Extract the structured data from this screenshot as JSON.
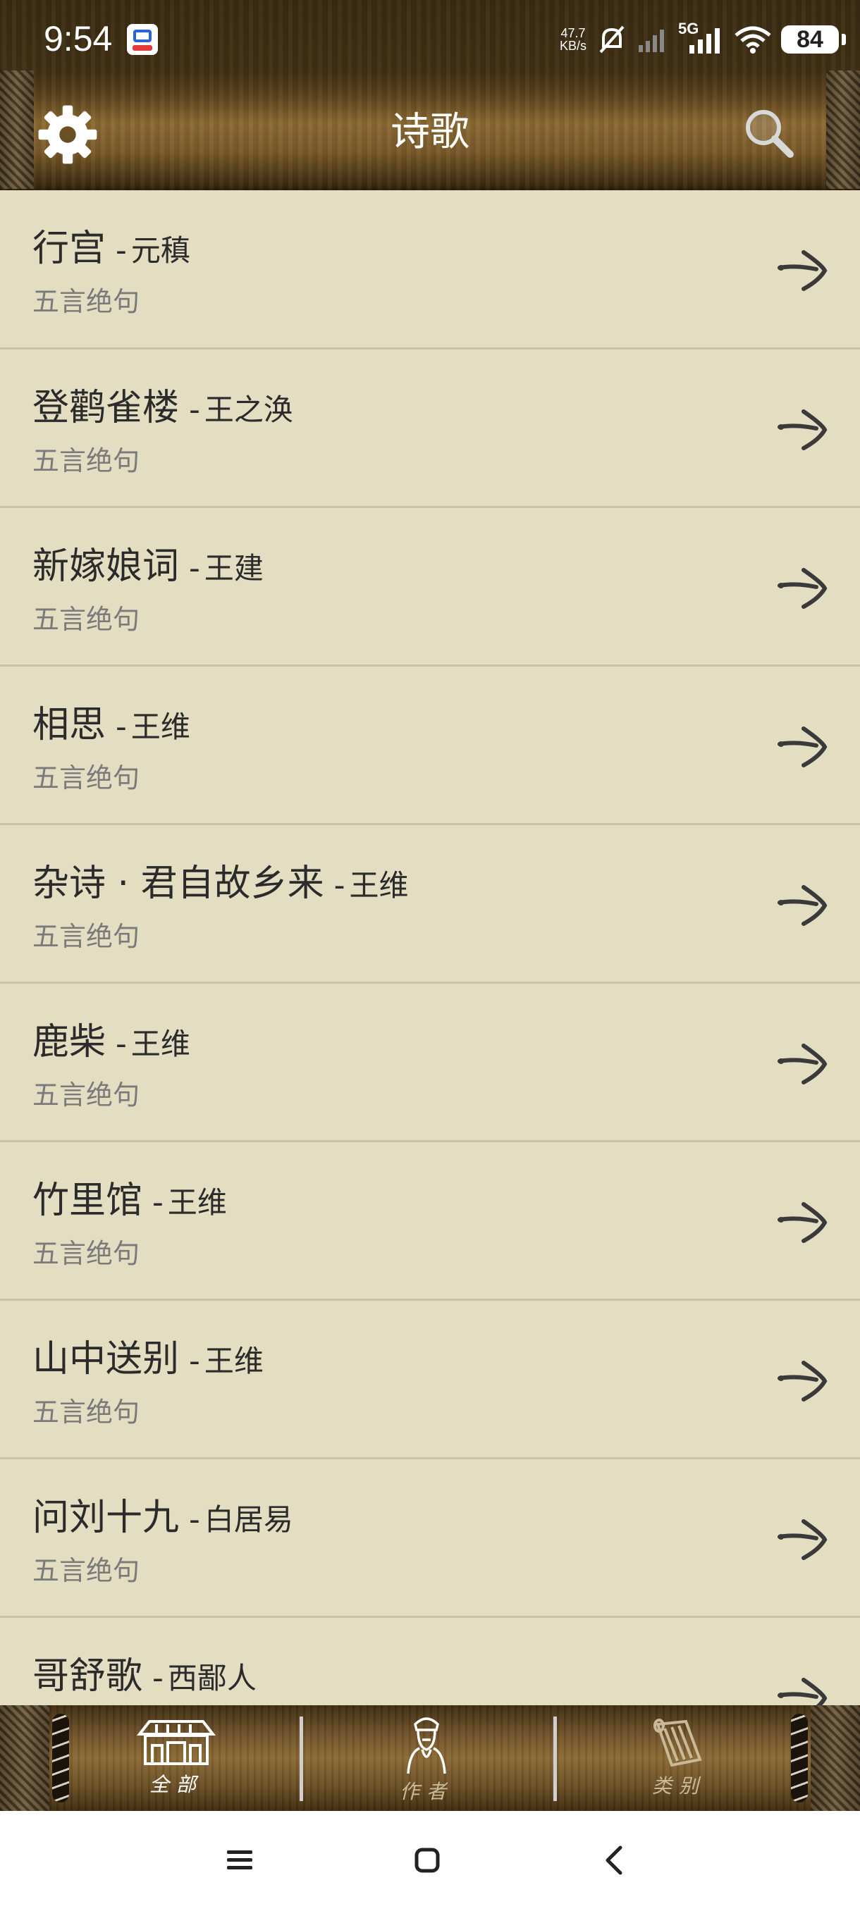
{
  "status_bar": {
    "time": "9:54",
    "net_speed_value": "47.7",
    "net_speed_unit": "KB/s",
    "network_type": "5G",
    "battery": "84"
  },
  "header": {
    "title": "诗歌"
  },
  "poems": [
    {
      "title": "行宫",
      "separator": "-",
      "author": "元稹",
      "type": "五言绝句"
    },
    {
      "title": "登鹳雀楼",
      "separator": "-",
      "author": "王之涣",
      "type": "五言绝句"
    },
    {
      "title": "新嫁娘词",
      "separator": "-",
      "author": "王建",
      "type": "五言绝句"
    },
    {
      "title": "相思",
      "separator": "-",
      "author": "王维",
      "type": "五言绝句"
    },
    {
      "title": "杂诗 · 君自故乡来",
      "separator": "-",
      "author": "王维",
      "type": "五言绝句"
    },
    {
      "title": "鹿柴",
      "separator": "-",
      "author": "王维",
      "type": "五言绝句"
    },
    {
      "title": "竹里馆",
      "separator": "-",
      "author": "王维",
      "type": "五言绝句"
    },
    {
      "title": "山中送别",
      "separator": "-",
      "author": "王维",
      "type": "五言绝句"
    },
    {
      "title": "问刘十九",
      "separator": "-",
      "author": "白居易",
      "type": "五言绝句"
    },
    {
      "title": "哥舒歌",
      "separator": "-",
      "author": "西鄙人",
      "type": ""
    }
  ],
  "tabs": [
    {
      "label": "全部",
      "icon": "building-icon",
      "active": true
    },
    {
      "label": "作者",
      "icon": "poet-portrait-icon",
      "active": false
    },
    {
      "label": "类别",
      "icon": "scroll-icon",
      "active": false
    }
  ],
  "colors": {
    "list_background": "#e3dec2",
    "divider": "#c9c4ac",
    "title_text": "#2b2b2b",
    "subtitle_text": "#7a7a7a",
    "header_wood": "#7a5b2a"
  }
}
